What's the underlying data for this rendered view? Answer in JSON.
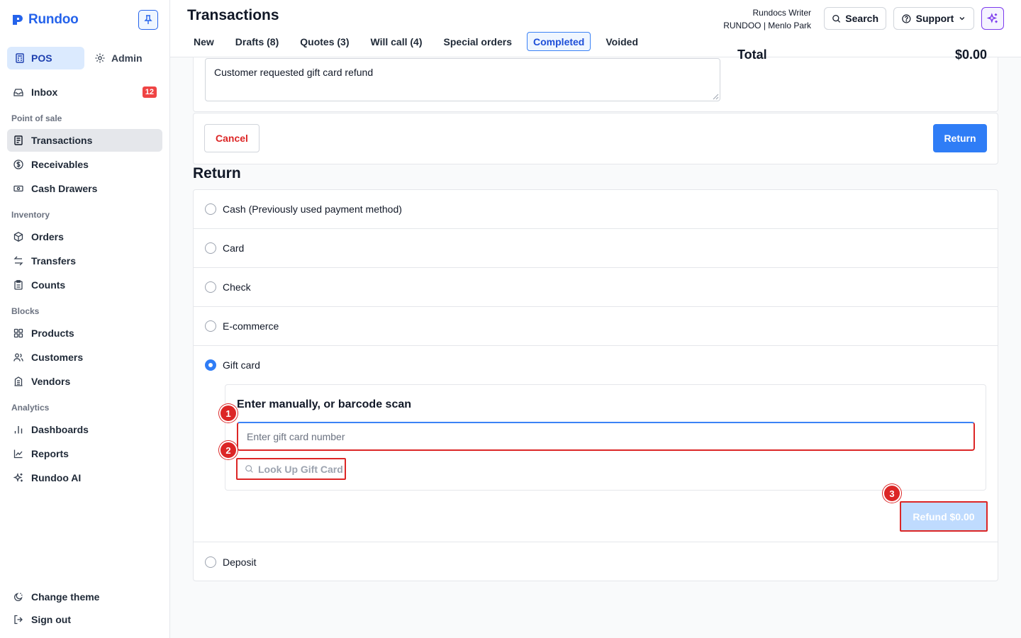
{
  "brand": {
    "name": "Rundoo",
    "color": "#2563eb"
  },
  "sidebar": {
    "modes": [
      {
        "label": "POS",
        "icon": "register-icon",
        "active": true
      },
      {
        "label": "Admin",
        "icon": "gear-icon",
        "active": false
      }
    ],
    "inbox": {
      "label": "Inbox",
      "badge": "12",
      "icon": "inbox-icon"
    },
    "sections": [
      {
        "title": "Point of sale",
        "items": [
          {
            "label": "Transactions",
            "icon": "receipt-icon",
            "active": true
          },
          {
            "label": "Receivables",
            "icon": "dollar-circle-icon"
          },
          {
            "label": "Cash Drawers",
            "icon": "cash-icon"
          }
        ]
      },
      {
        "title": "Inventory",
        "items": [
          {
            "label": "Orders",
            "icon": "box-icon"
          },
          {
            "label": "Transfers",
            "icon": "arrows-swap-icon"
          },
          {
            "label": "Counts",
            "icon": "clipboard-icon"
          }
        ]
      },
      {
        "title": "Blocks",
        "items": [
          {
            "label": "Products",
            "icon": "grid-icon"
          },
          {
            "label": "Customers",
            "icon": "users-icon"
          },
          {
            "label": "Vendors",
            "icon": "building-icon"
          }
        ]
      },
      {
        "title": "Analytics",
        "items": [
          {
            "label": "Dashboards",
            "icon": "bar-chart-icon"
          },
          {
            "label": "Reports",
            "icon": "line-chart-icon"
          },
          {
            "label": "Rundoo AI",
            "icon": "sparkles-icon"
          }
        ]
      }
    ],
    "footer": [
      {
        "label": "Change theme",
        "icon": "theme-icon"
      },
      {
        "label": "Sign out",
        "icon": "sign-out-icon"
      }
    ]
  },
  "header": {
    "title": "Transactions",
    "tabs": [
      "New",
      "Drafts (8)",
      "Quotes (3)",
      "Will call (4)",
      "Special orders",
      "Completed",
      "Voided"
    ],
    "active_tab": "Completed",
    "user_name": "Rundocs Writer",
    "store": "RUNDOO | Menlo Park",
    "search_label": "Search",
    "support_label": "Support"
  },
  "main": {
    "note_text": "Customer requested gift card refund",
    "total_label": "Total",
    "total_value": "$0.00",
    "cancel_label": "Cancel",
    "return_label": "Return",
    "return_section_title": "Return",
    "payment_options": [
      {
        "label": "Cash (Previously used payment method)",
        "selected": false
      },
      {
        "label": "Card",
        "selected": false
      },
      {
        "label": "Check",
        "selected": false
      },
      {
        "label": "E-commerce",
        "selected": false
      },
      {
        "label": "Gift card",
        "selected": true
      },
      {
        "label": "Deposit",
        "selected": false
      }
    ],
    "gift_card": {
      "label": "Enter manually, or barcode scan",
      "placeholder": "Enter gift card number",
      "lookup_label": "Look Up Gift Card",
      "refund_label": "Refund $0.00"
    },
    "markers": [
      "1",
      "2",
      "3"
    ]
  }
}
